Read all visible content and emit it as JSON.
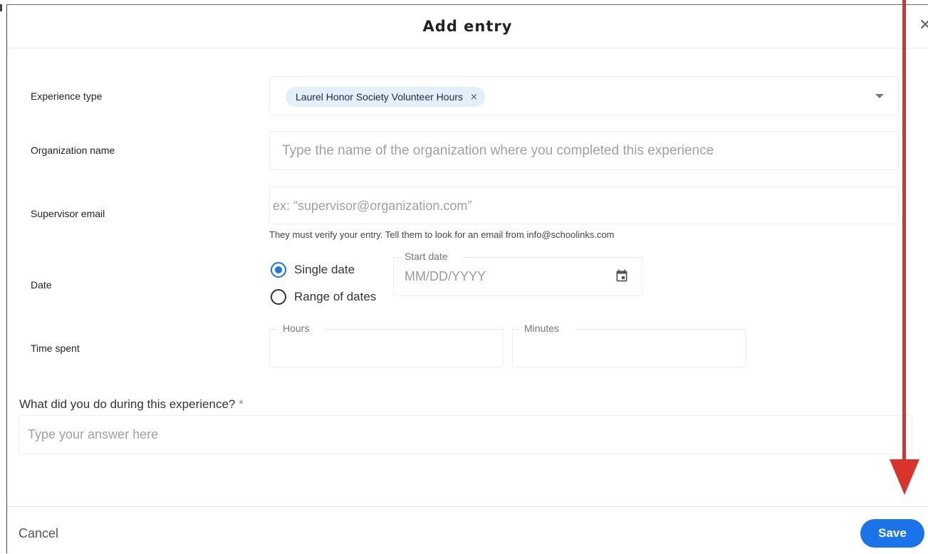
{
  "modal": {
    "title": "Add entry",
    "close_icon": "close-icon"
  },
  "form": {
    "experience_type": {
      "label": "Experience type",
      "selected_chip": "Laurel Honor Society Volunteer Hours",
      "chip_remove": "×"
    },
    "organization_name": {
      "label": "Organization name",
      "placeholder": "Type the name of the organization where you completed this experience"
    },
    "supervisor_email": {
      "label": "Supervisor email",
      "placeholder": "ex: “supervisor@organization.com”",
      "helper": "They must verify your entry. Tell them to look for an email from info@schoolinks.com"
    },
    "date": {
      "label": "Date",
      "options": [
        {
          "label": "Single date",
          "checked": true
        },
        {
          "label": "Range of dates",
          "checked": false
        }
      ],
      "start_date_label": "Start date",
      "start_date_placeholder": "MM/DD/YYYY",
      "icon": "calendar-icon"
    },
    "time_spent": {
      "label": "Time spent",
      "hours_label": "Hours",
      "minutes_label": "Minutes"
    },
    "question": {
      "label": "What did you do during this experience?",
      "required_mark": "*",
      "placeholder": "Type your answer here"
    }
  },
  "footer": {
    "cancel_label": "Cancel",
    "save_label": "Save"
  },
  "colors": {
    "accent": "#1a73e8",
    "chip_bg": "#e3f0fb",
    "annotation_arrow": "#d9342b"
  }
}
